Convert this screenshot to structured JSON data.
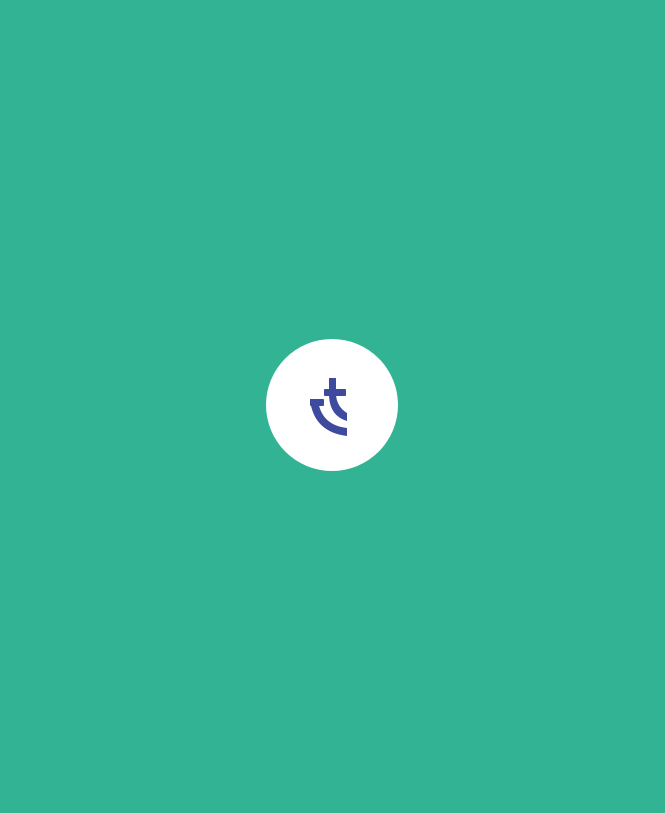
{
  "screen": {
    "type": "splash",
    "background_color": "#32b393"
  },
  "logo": {
    "icon": "app-logo-icon",
    "badge_color": "#ffffff",
    "mark_color": "#3d4a9e"
  }
}
